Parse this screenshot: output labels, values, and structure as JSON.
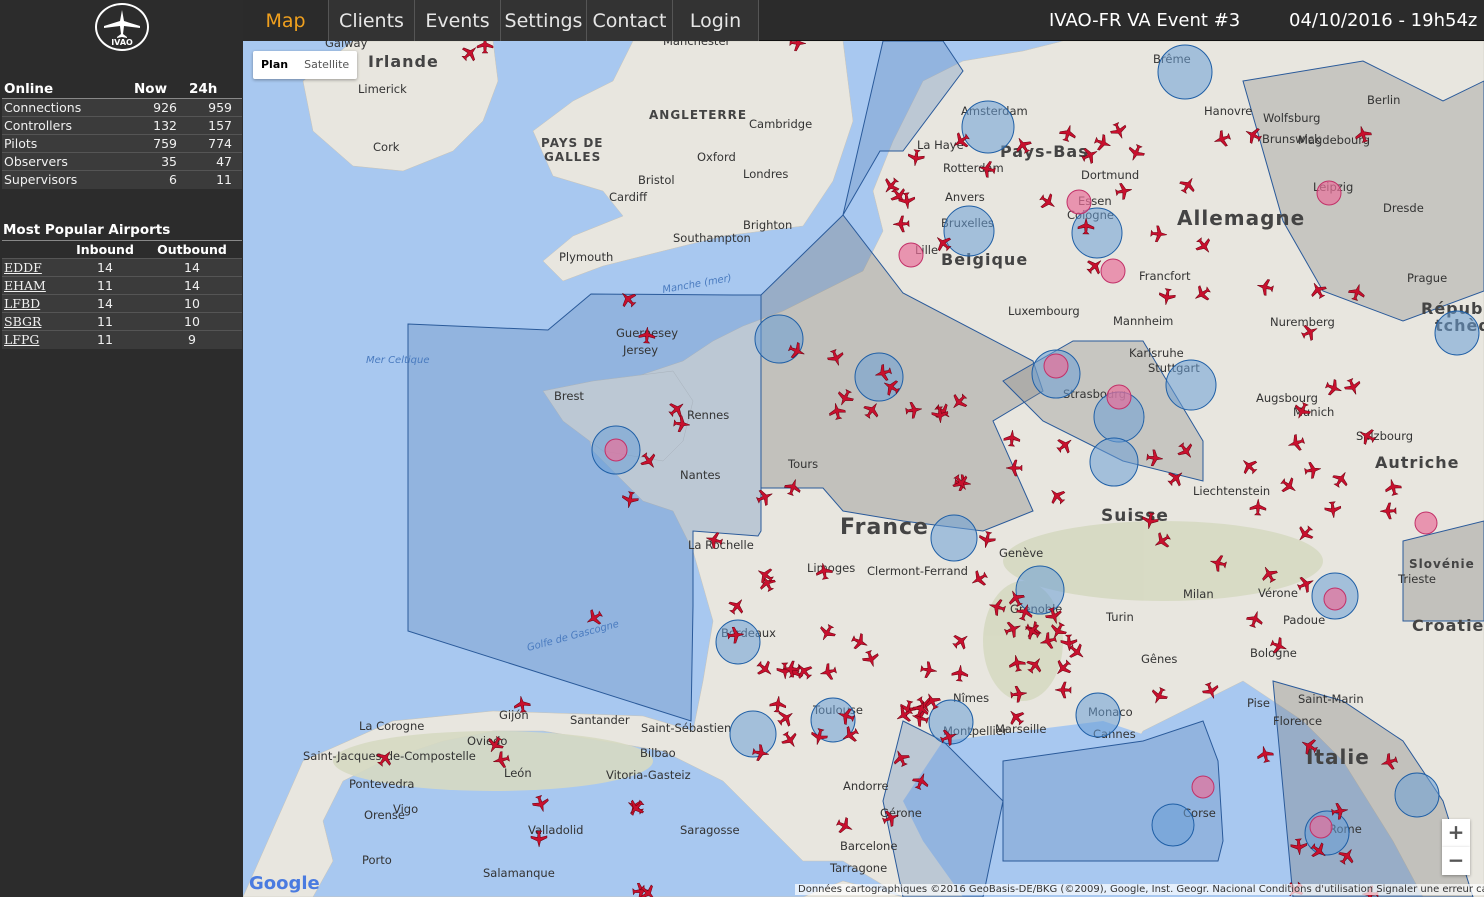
{
  "sidebar": {
    "logo_text": "IVAO",
    "online": {
      "headers": [
        "Online",
        "Now",
        "24h"
      ],
      "rows": [
        {
          "label": "Connections",
          "now": "926",
          "day": "959"
        },
        {
          "label": "Controllers",
          "now": "132",
          "day": "157"
        },
        {
          "label": "Pilots",
          "now": "759",
          "day": "774"
        },
        {
          "label": "Observers",
          "now": "35",
          "day": "47"
        },
        {
          "label": "Supervisors",
          "now": "6",
          "day": "11"
        }
      ]
    },
    "airports": {
      "title": "Most Popular Airports",
      "headers": [
        "",
        "Inbound",
        "Outbound"
      ],
      "rows": [
        {
          "code": "EDDF",
          "inbound": "14",
          "outbound": "14"
        },
        {
          "code": "EHAM",
          "inbound": "11",
          "outbound": "14"
        },
        {
          "code": "LFBD",
          "inbound": "14",
          "outbound": "10"
        },
        {
          "code": "SBGR",
          "inbound": "11",
          "outbound": "10"
        },
        {
          "code": "LFPG",
          "inbound": "11",
          "outbound": "9"
        }
      ]
    }
  },
  "nav": {
    "items": [
      "Map",
      "Clients",
      "Events",
      "Settings",
      "Contact",
      "Login"
    ],
    "active": "Map",
    "event_title": "IVAO-FR VA Event #3",
    "datetime": "04/10/2016 - 19h54z"
  },
  "map": {
    "map_type": [
      "Plan",
      "Satellite"
    ],
    "zoom_in": "+",
    "zoom_out": "−",
    "google": "Google",
    "attribution": "Données cartographiques ©2016 GeoBasis-DE/BKG (©2009), Google, Inst. Geogr. Nacional   Conditions d'utilisation   Signaler une erreur cartographique",
    "countries": [
      "Irlande",
      "ANGLETERRE",
      "PAYS DE",
      "GALLES",
      "Pays-Bas",
      "Allemagne",
      "Belgique",
      "France",
      "Suisse",
      "Autriche",
      "Italie",
      "Républi",
      "tchèq",
      "Slovénie",
      "Croatie"
    ],
    "cities": [
      "Galway",
      "Manchester",
      "Limerick",
      "Cork",
      "Cambridge",
      "Oxford",
      "Londres",
      "Bristol",
      "Cardiff",
      "Brighton",
      "Southampton",
      "Plymouth",
      "Amsterdam",
      "La Haye",
      "Rotterdam",
      "Anvers",
      "Bruxelles",
      "Lille",
      "Brême",
      "Hanovre",
      "Wolfsburg",
      "Berlin",
      "Brunswick",
      "Magdebourg",
      "Dortmund",
      "Essen",
      "Cologne",
      "Leipzig",
      "Dresde",
      "Francfort",
      "Prague",
      "Luxembourg",
      "Nuremberg",
      "Mannheim",
      "Karlsruhe",
      "Stuttgart",
      "Strasbourg",
      "Augsbourg",
      "Munich",
      "Salzbourg",
      "Guernesey",
      "Jersey",
      "Brest",
      "Rennes",
      "Nantes",
      "Tours",
      "La Rochelle",
      "Limoges",
      "Clermont-Ferrand",
      "Genève",
      "Grenoble",
      "Turin",
      "Milan",
      "Vérone",
      "Padoue",
      "Trieste",
      "Liechtenstein",
      "Bordeaux",
      "Toulouse",
      "Nîmes",
      "Montpellier",
      "Marseille",
      "Monaco",
      "Cannes",
      "Gênes",
      "Bologne",
      "Saint-Marin",
      "Pise",
      "Florence",
      "Rome",
      "Andorre",
      "Gérone",
      "Barcelone",
      "Tarragone",
      "Saragosse",
      "Valladolid",
      "Vitoria-Gasteiz",
      "Bilbao",
      "Saint-Sébastien",
      "Santander",
      "Gijón",
      "Oviedo",
      "León",
      "La Corogne",
      "Saint-Jacques-de-Compostelle",
      "Pontevedra",
      "Vigo",
      "Orense",
      "Porto",
      "Salamanque",
      "Corse"
    ],
    "seas": [
      "Mer Celtique",
      "Manche (mer)",
      "Golfe de Gascogne"
    ]
  }
}
